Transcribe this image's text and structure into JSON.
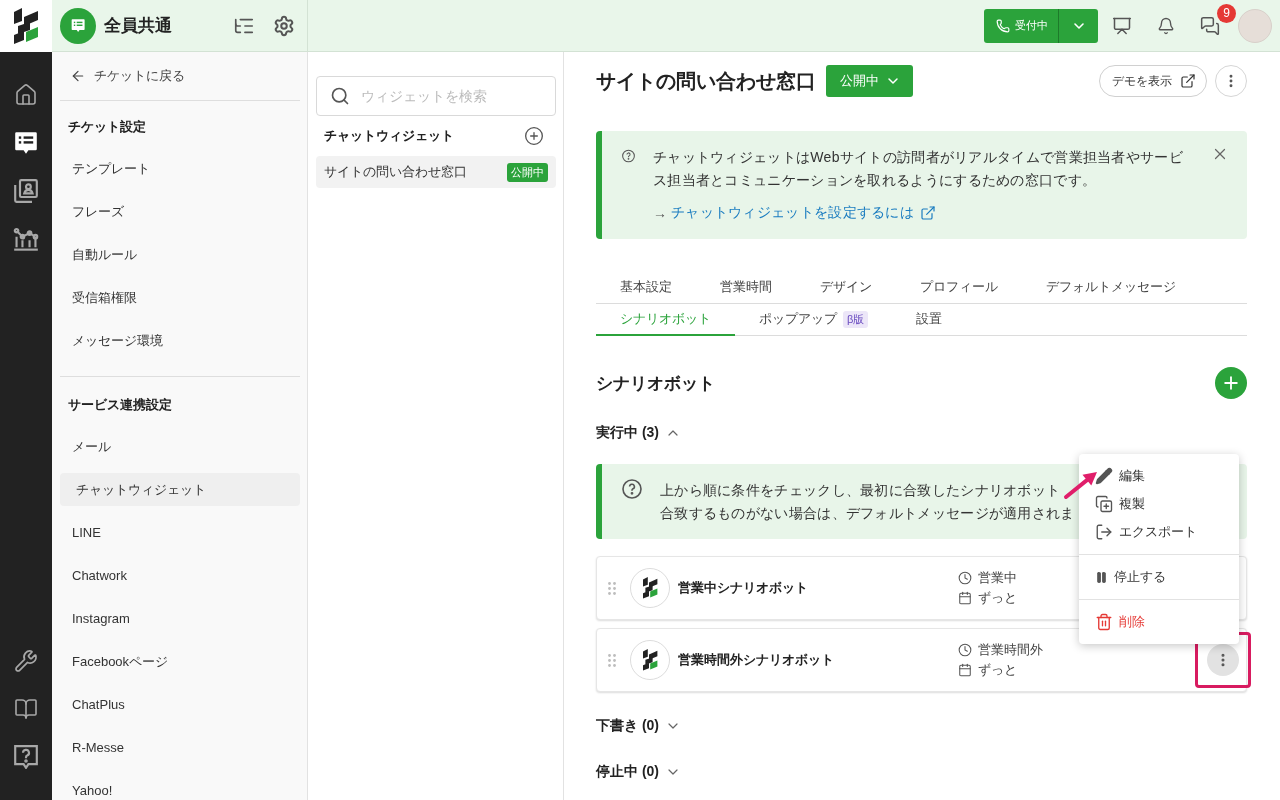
{
  "topbar": {
    "workspace": "全員共通",
    "status_button": "受付中",
    "chat_badge": "9"
  },
  "rail": {
    "top_items": [
      {
        "selected": false
      },
      {
        "selected": true
      },
      {
        "selected": false
      },
      {
        "selected": false
      }
    ]
  },
  "settings_nav": {
    "back_link": "チケットに戻る",
    "sections": [
      {
        "title": "チケット設定",
        "items": [
          {
            "label": "テンプレート",
            "selected": false
          },
          {
            "label": "フレーズ",
            "selected": false
          },
          {
            "label": "自動ルール",
            "selected": false
          },
          {
            "label": "受信箱権限",
            "selected": false
          },
          {
            "label": "メッセージ環境",
            "selected": false
          }
        ]
      },
      {
        "title": "サービス連携設定",
        "items": [
          {
            "label": "メール",
            "selected": false
          },
          {
            "label": "チャットウィジェット",
            "selected": true
          },
          {
            "label": "LINE",
            "selected": false
          },
          {
            "label": "Chatwork",
            "selected": false
          },
          {
            "label": "Instagram",
            "selected": false
          },
          {
            "label": "Facebookページ",
            "selected": false
          },
          {
            "label": "ChatPlus",
            "selected": false
          },
          {
            "label": "R-Messe",
            "selected": false
          },
          {
            "label": "Yahoo!",
            "selected": false
          }
        ]
      }
    ]
  },
  "widget_list": {
    "search": {
      "placeholder": "ウィジェットを検索"
    },
    "title": "チャットウィジェット",
    "items": [
      {
        "name": "サイトの問い合わせ窓口",
        "badge": "公開中",
        "selected": true
      }
    ]
  },
  "page": {
    "title": "サイトの問い合わせ窓口",
    "status": "公開中",
    "demo_button": "デモを表示"
  },
  "intro_notice": {
    "text": "チャットウィジェットはWebサイトの訪問者がリアルタイムで営業担当者やサービス担当者とコミュニケーションを取れるようにするための窓口です。",
    "arrow": "→",
    "link": "チャットウィジェットを設定するには"
  },
  "tab_rows": [
    [
      {
        "label": "基本設定",
        "selected": false
      },
      {
        "label": "営業時間",
        "selected": false
      },
      {
        "label": "デザイン",
        "selected": false
      },
      {
        "label": "プロフィール",
        "selected": false
      },
      {
        "label": "デフォルトメッセージ",
        "selected": false
      }
    ],
    [
      {
        "label": "シナリオボット",
        "selected": true
      },
      {
        "label": "ポップアップ",
        "badge": "β版",
        "selected": false
      },
      {
        "label": "設置",
        "selected": false
      }
    ]
  ],
  "section": {
    "title": "シナリオボット"
  },
  "groups": [
    {
      "label": "実行中 (3)",
      "expanded": true,
      "notice_lines": [
        "上から順に条件をチェックし、最初に合致したシナリオボット",
        "合致するものがない場合は、デフォルトメッセージが適用されま"
      ],
      "bots": [
        {
          "name": "営業中シナリオボット",
          "schedule": "営業中",
          "period": "ずっと",
          "menu_open": false
        },
        {
          "name": "営業時間外シナリオボット",
          "schedule": "営業時間外",
          "period": "ずっと",
          "menu_open": true
        }
      ]
    },
    {
      "label": "下書き (0)",
      "expanded": false
    },
    {
      "label": "停止中 (0)",
      "expanded": false
    }
  ],
  "context_menu": {
    "groups": [
      [
        {
          "label": "編集",
          "kind": "edit"
        },
        {
          "label": "複製",
          "kind": "duplicate"
        },
        {
          "label": "エクスポート",
          "kind": "export"
        }
      ],
      [
        {
          "label": "停止する",
          "kind": "pause"
        }
      ],
      [
        {
          "label": "削除",
          "kind": "delete"
        }
      ]
    ]
  }
}
